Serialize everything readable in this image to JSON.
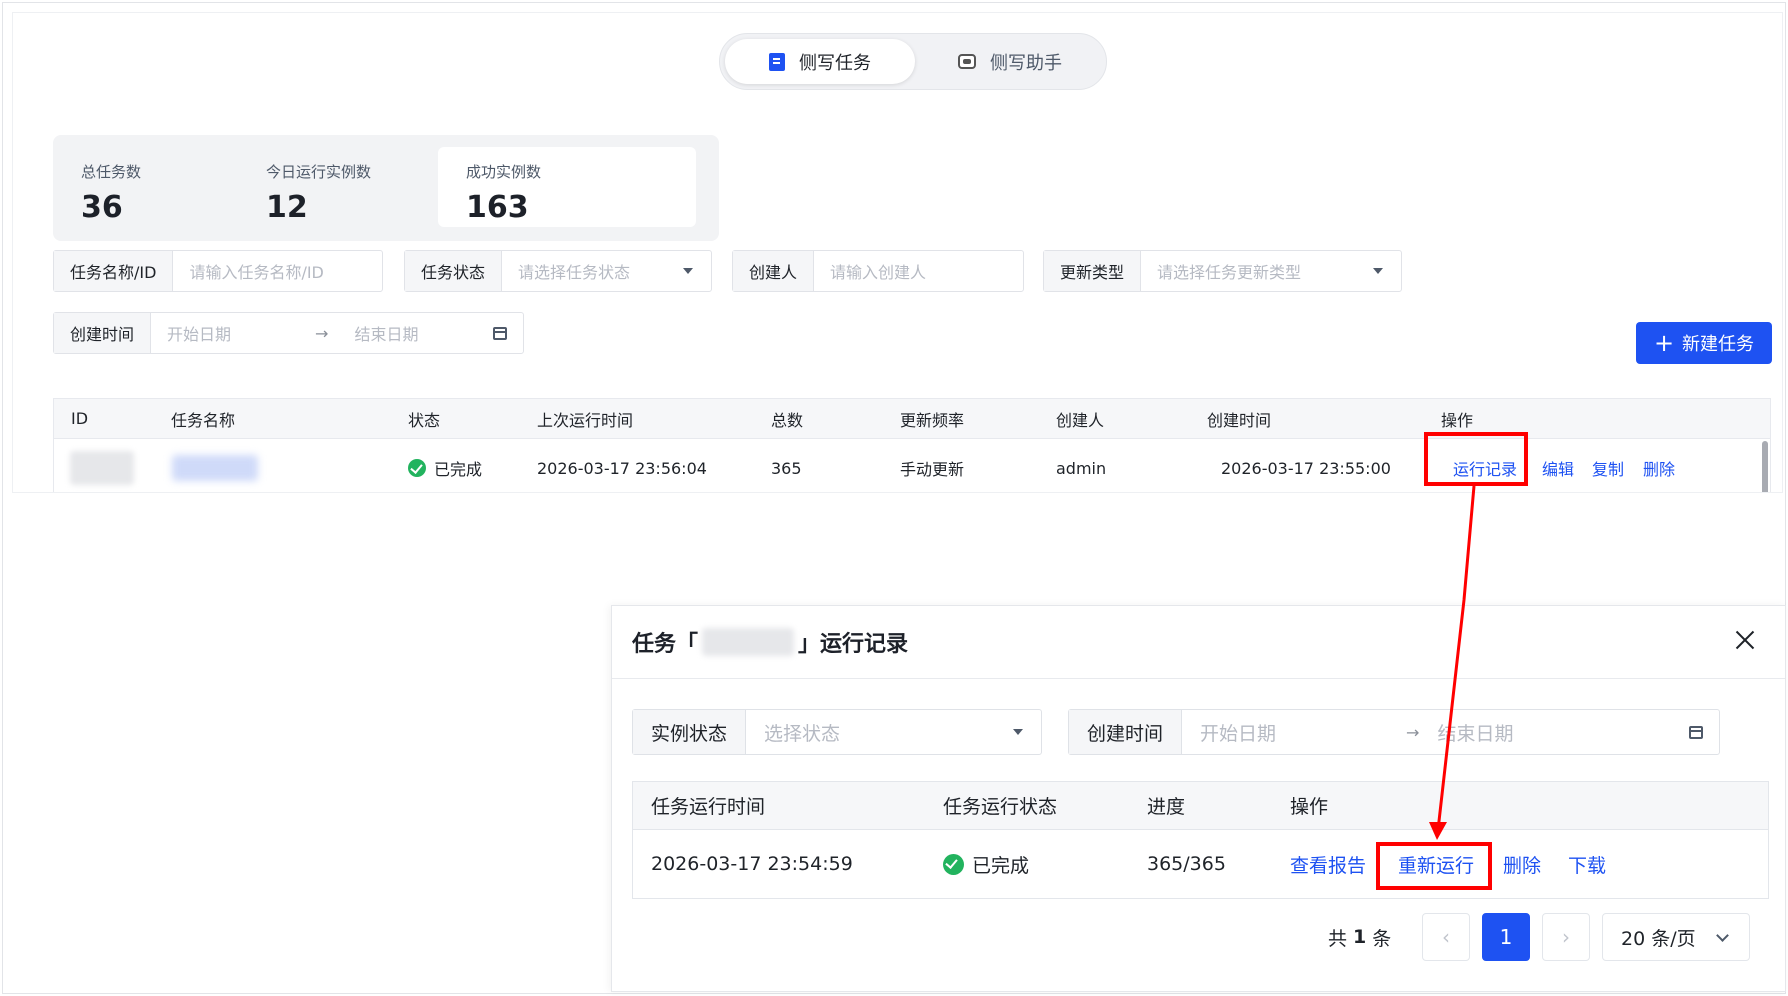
{
  "tabs": [
    {
      "label": "侧写任务",
      "active": true,
      "icon": "document-icon"
    },
    {
      "label": "侧写助手",
      "active": false,
      "icon": "robot-icon"
    }
  ],
  "stats": [
    {
      "label": "总任务数",
      "value": "36"
    },
    {
      "label": "今日运行实例数",
      "value": "12"
    },
    {
      "label": "成功实例数",
      "value": "163"
    }
  ],
  "filters": {
    "task_name": {
      "label": "任务名称/ID",
      "placeholder": "请输入任务名称/ID"
    },
    "task_status": {
      "label": "任务状态",
      "placeholder": "请选择任务状态"
    },
    "creator": {
      "label": "创建人",
      "placeholder": "请输入创建人"
    },
    "update_type": {
      "label": "更新类型",
      "placeholder": "请选择任务更新类型"
    },
    "created_time": {
      "label": "创建时间",
      "start_placeholder": "开始日期",
      "end_placeholder": "结束日期",
      "separator": "→"
    }
  },
  "new_task_button": "新建任务",
  "task_table": {
    "columns": [
      "ID",
      "任务名称",
      "状态",
      "上次运行时间",
      "总数",
      "更新频率",
      "创建人",
      "创建时间",
      "操作"
    ],
    "rows": [
      {
        "status": "已完成",
        "last_run": "2026-03-17 23:56:04",
        "total": "365",
        "frequency": "手动更新",
        "creator": "admin",
        "created": "2026-03-17 23:55:00",
        "actions": [
          "运行记录",
          "编辑",
          "复制",
          "删除"
        ]
      }
    ]
  },
  "drawer": {
    "title_prefix": "任务「",
    "title_suffix": "」运行记录",
    "filters": {
      "instance_status": {
        "label": "实例状态",
        "placeholder": "选择状态"
      },
      "created_time": {
        "label": "创建时间",
        "start_placeholder": "开始日期",
        "end_placeholder": "结束日期",
        "separator": "→"
      }
    },
    "table": {
      "columns": [
        "任务运行时间",
        "任务运行状态",
        "进度",
        "操作"
      ],
      "rows": [
        {
          "run_time": "2026-03-17 23:54:59",
          "status": "已完成",
          "progress": "365/365",
          "actions": [
            "查看报告",
            "重新运行",
            "删除",
            "下载"
          ]
        }
      ]
    },
    "pagination": {
      "total_prefix": "共",
      "total": "1",
      "total_suffix": "条",
      "current_page": "1",
      "page_size": "20 条/页"
    }
  },
  "colors": {
    "primary": "#1e52f2",
    "success": "#22b35e",
    "annotation": "#ff0000"
  }
}
